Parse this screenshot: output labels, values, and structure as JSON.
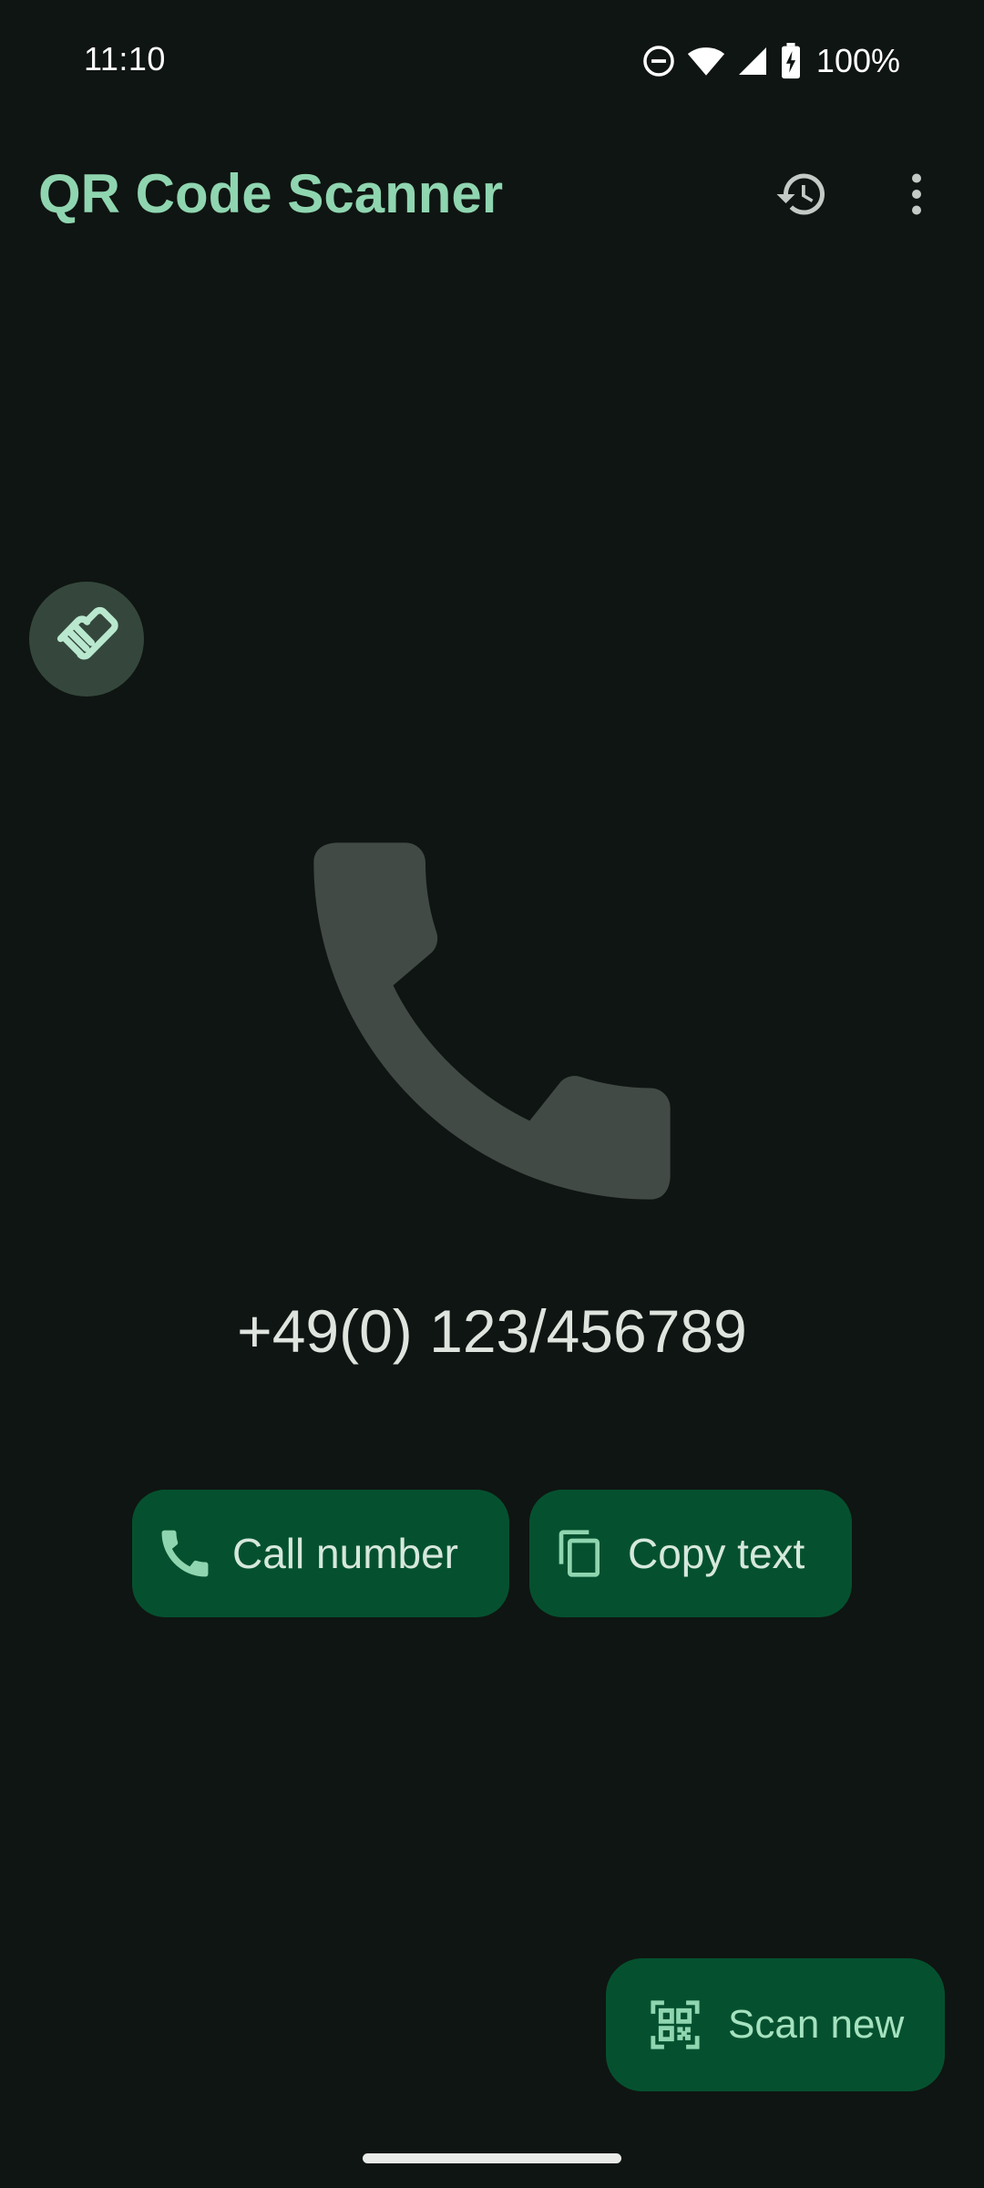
{
  "status_bar": {
    "time": "11:10",
    "battery": "100%",
    "icons": [
      "do-not-disturb-icon",
      "wifi-icon",
      "cell-signal-icon",
      "battery-charging-icon"
    ]
  },
  "app_bar": {
    "title": "QR Code Scanner",
    "actions": [
      "history-icon",
      "more-vert-icon"
    ]
  },
  "result": {
    "type_icon": "phone-icon",
    "value": "+49(0) 123/456789"
  },
  "actions": {
    "call_label": "Call number",
    "copy_label": "Copy text"
  },
  "fab": {
    "label": "Scan new"
  },
  "colors": {
    "background": "#0f1512",
    "accent": "#8fd5b0",
    "button": "#05512f",
    "hero_icon": "#414a45"
  }
}
